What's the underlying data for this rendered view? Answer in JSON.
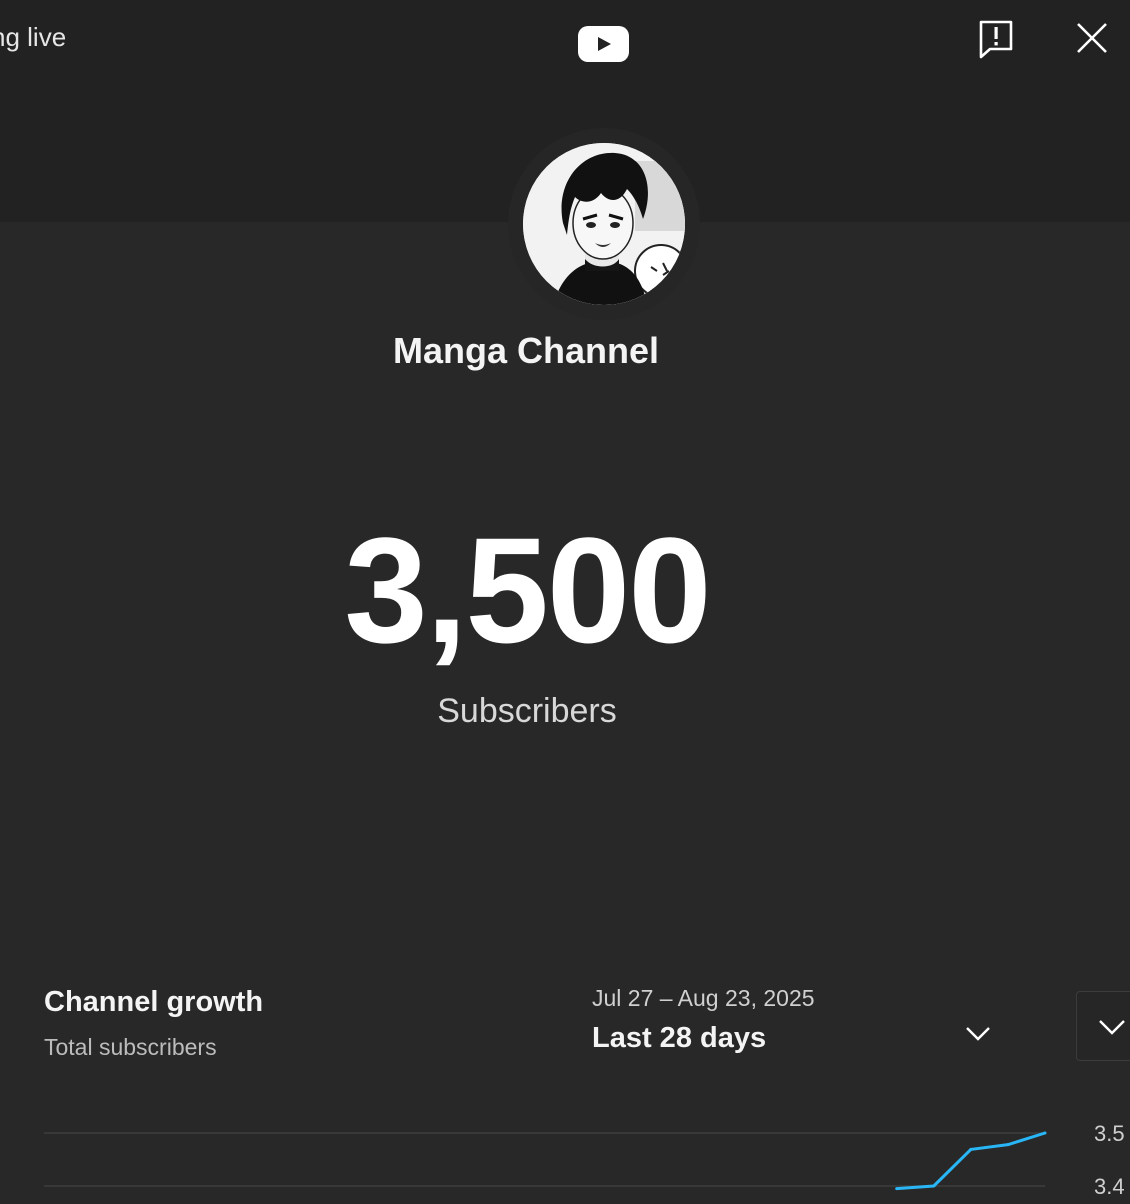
{
  "header": {
    "partial_title": "ng live",
    "logo_icon": "youtube-logo-icon",
    "report_icon": "report-flag-icon",
    "close_icon": "close-icon"
  },
  "channel": {
    "name": "Manga Channel",
    "avatar_icon": "manga-character-avatar"
  },
  "stats": {
    "subscriber_count": "3,500",
    "subscriber_label": "Subscribers"
  },
  "growth": {
    "title": "Channel growth",
    "subtitle": "Total subscribers",
    "date_range": "Jul 27 – Aug 23, 2025",
    "period": "Last 28 days"
  },
  "colors": {
    "background": "#282828",
    "header_background": "#222222",
    "line_series": "#29b6f6",
    "brand_red": "#ff0000"
  },
  "chart_data": {
    "type": "line",
    "series": [
      {
        "values": [
          {
            "x": 24,
            "y": 3395
          },
          {
            "x": 25,
            "y": 3400
          },
          {
            "x": 26,
            "y": 3469
          },
          {
            "x": 27,
            "y": 3478
          },
          {
            "x": 28,
            "y": 3500
          }
        ]
      }
    ],
    "xlim": [
      1,
      28
    ],
    "ylim_visible": [
      3400,
      3500
    ],
    "y_tick_labels": [
      "3.5",
      "3.4"
    ],
    "grid": true
  }
}
